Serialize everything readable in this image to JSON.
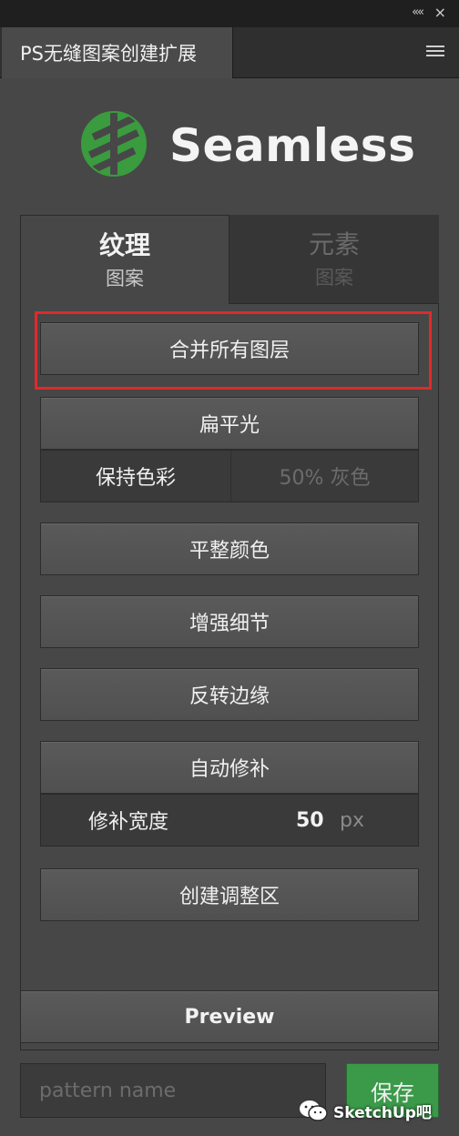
{
  "header": {
    "collapse_glyph": "««",
    "close_glyph": "×",
    "panel_tab_label": "PS无缝图案创建扩展"
  },
  "brand": {
    "logo_text": "Seamless",
    "logo_color": "#3a9b3f"
  },
  "tabs": [
    {
      "title": "纹理",
      "subtitle": "图案",
      "active": true
    },
    {
      "title": "元素",
      "subtitle": "图案",
      "active": false
    }
  ],
  "buttons": {
    "merge_layers": "合并所有图层",
    "flat_light": "扁平光",
    "flatten_color": "平整颜色",
    "enhance_detail": "增强细节",
    "invert_edges": "反转边缘",
    "auto_patch": "自动修补",
    "create_adjust_zone": "创建调整区",
    "preview": "Preview",
    "save": "保存"
  },
  "flat_light_row": {
    "left_label": "保持色彩",
    "right_label": "50% 灰色"
  },
  "patch_width_row": {
    "label": "修补宽度",
    "value": "50",
    "unit": "px"
  },
  "pattern_name": {
    "placeholder": "pattern name",
    "value": ""
  },
  "watermark": {
    "text": "SketchUp吧"
  },
  "colors": {
    "highlight_border": "#e02a2a",
    "save_button": "#3b9a4a"
  }
}
